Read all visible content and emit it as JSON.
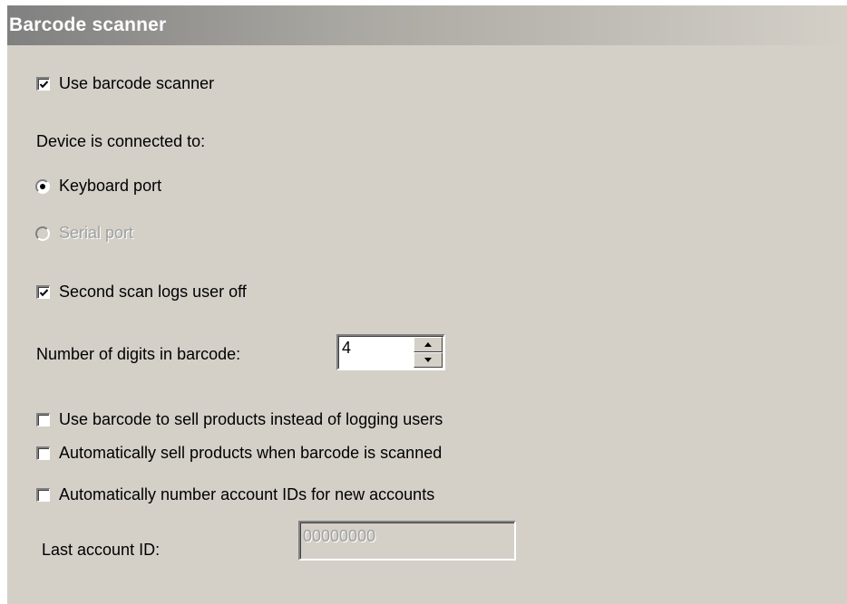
{
  "header": {
    "title": "Barcode scanner"
  },
  "options": {
    "use_barcode_scanner": {
      "label": "Use barcode scanner",
      "checked": true
    },
    "device_connected_label": "Device is connected to:",
    "keyboard_port": {
      "label": "Keyboard port",
      "selected": true
    },
    "serial_port": {
      "label": "Serial port",
      "selected": false,
      "disabled": true
    },
    "second_scan_logs_off": {
      "label": "Second scan logs user off",
      "checked": true
    },
    "digits": {
      "label": "Number of digits in barcode:",
      "value": "4"
    },
    "sell_products": {
      "label": "Use barcode to sell products instead of logging users",
      "checked": false
    },
    "auto_sell": {
      "label": "Automatically sell products when barcode is scanned",
      "checked": false
    },
    "auto_number": {
      "label": "Automatically number account IDs for new accounts",
      "checked": false
    },
    "last_account_id": {
      "label": "Last account ID:",
      "value": "00000000",
      "disabled": true
    }
  },
  "colors": {
    "panel_bg": "#d4d0c8",
    "header_gradient_start": "#808080",
    "header_text": "#ffffff",
    "disabled_text": "#a0a0a0"
  }
}
